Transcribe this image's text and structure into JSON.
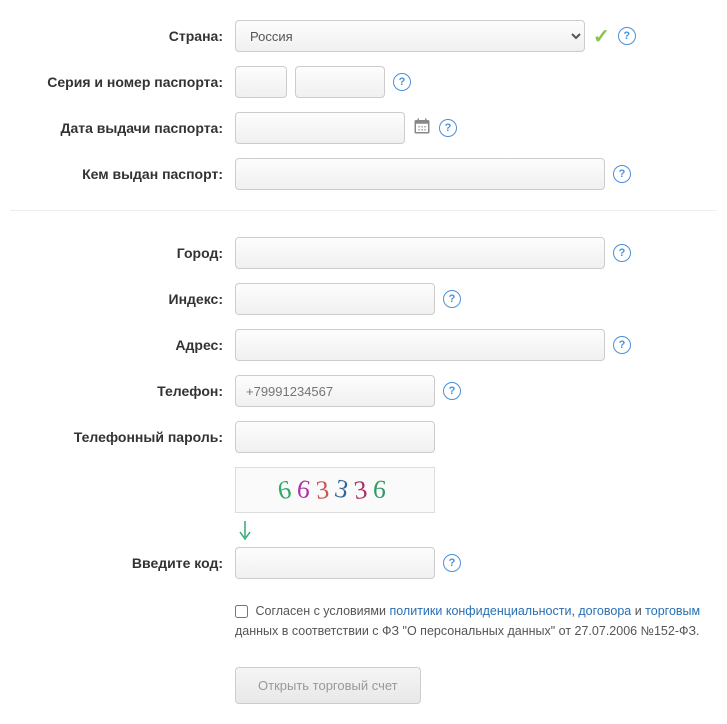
{
  "fields": {
    "country": {
      "label": "Страна:",
      "value": "Россия"
    },
    "passport_sn": {
      "label": "Серия и номер паспорта:"
    },
    "passport_date": {
      "label": "Дата выдачи паспорта:"
    },
    "passport_issued": {
      "label": "Кем выдан паспорт:"
    },
    "city": {
      "label": "Город:"
    },
    "zip": {
      "label": "Индекс:"
    },
    "address": {
      "label": "Адрес:"
    },
    "phone": {
      "label": "Телефон:",
      "placeholder": "+79991234567"
    },
    "phone_pwd": {
      "label": "Телефонный пароль:"
    },
    "captcha": {
      "label": "Введите код:",
      "code": "663336"
    }
  },
  "consent": {
    "prefix": "Согласен с условиями ",
    "link1": "политики конфиденциальности",
    "sep1": ", ",
    "link2": "договора",
    "sep2": " и ",
    "link3": "торговым ",
    "suffix": "данных в соответствии с ФЗ \"О персональных данных\" от 27.07.2006 №152-ФЗ."
  },
  "submit": "Открыть торговый счет"
}
